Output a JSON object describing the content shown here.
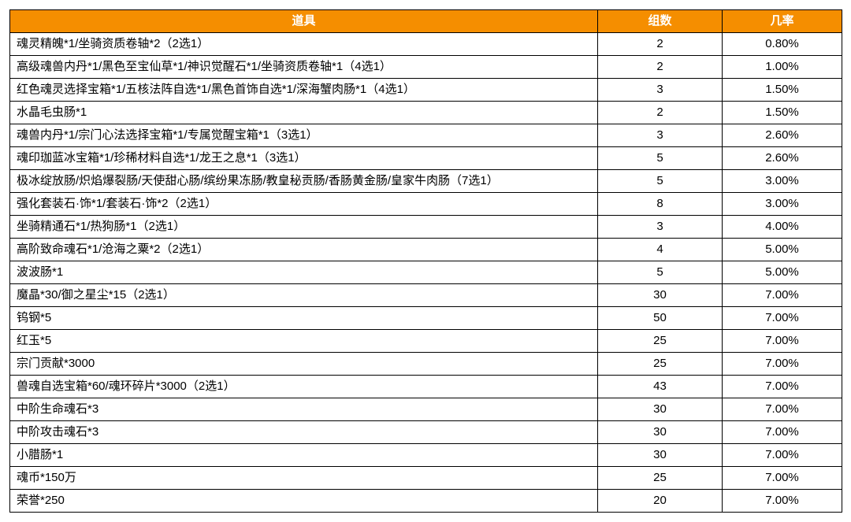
{
  "chart_data": {
    "type": "table",
    "title": "",
    "columns": [
      "道具",
      "组数",
      "几率"
    ],
    "rows": [
      {
        "item": "魂灵精魄*1/坐骑资质卷轴*2（2选1）",
        "count": 2,
        "rate": "0.80%"
      },
      {
        "item": "高级魂兽内丹*1/黑色至宝仙草*1/神识觉醒石*1/坐骑资质卷轴*1（4选1）",
        "count": 2,
        "rate": "1.00%"
      },
      {
        "item": "红色魂灵选择宝箱*1/五核法阵自选*1/黑色首饰自选*1/深海蟹肉肠*1（4选1）",
        "count": 3,
        "rate": "1.50%"
      },
      {
        "item": "水晶毛虫肠*1",
        "count": 2,
        "rate": "1.50%"
      },
      {
        "item": "魂兽内丹*1/宗门心法选择宝箱*1/专属觉醒宝箱*1（3选1）",
        "count": 3,
        "rate": "2.60%"
      },
      {
        "item": "魂印珈蓝冰宝箱*1/珍稀材料自选*1/龙王之息*1（3选1）",
        "count": 5,
        "rate": "2.60%"
      },
      {
        "item": "极冰绽放肠/炽焰爆裂肠/天使甜心肠/缤纷果冻肠/教皇秘贡肠/香肠黄金肠/皇家牛肉肠（7选1）",
        "count": 5,
        "rate": "3.00%"
      },
      {
        "item": "强化套装石·饰*1/套装石·饰*2（2选1）",
        "count": 8,
        "rate": "3.00%"
      },
      {
        "item": "坐骑精通石*1/热狗肠*1（2选1）",
        "count": 3,
        "rate": "4.00%"
      },
      {
        "item": "高阶致命魂石*1/沧海之粟*2（2选1）",
        "count": 4,
        "rate": "5.00%"
      },
      {
        "item": "波波肠*1",
        "count": 5,
        "rate": "5.00%"
      },
      {
        "item": "魔晶*30/御之星尘*15（2选1）",
        "count": 30,
        "rate": "7.00%"
      },
      {
        "item": "钨钢*5",
        "count": 50,
        "rate": "7.00%"
      },
      {
        "item": "红玉*5",
        "count": 25,
        "rate": "7.00%"
      },
      {
        "item": "宗门贡献*3000",
        "count": 25,
        "rate": "7.00%"
      },
      {
        "item": "兽魂自选宝箱*60/魂环碎片*3000（2选1）",
        "count": 43,
        "rate": "7.00%"
      },
      {
        "item": "中阶生命魂石*3",
        "count": 30,
        "rate": "7.00%"
      },
      {
        "item": "中阶攻击魂石*3",
        "count": 30,
        "rate": "7.00%"
      },
      {
        "item": "小腊肠*1",
        "count": 30,
        "rate": "7.00%"
      },
      {
        "item": "魂币*150万",
        "count": 25,
        "rate": "7.00%"
      },
      {
        "item": "荣誉*250",
        "count": 20,
        "rate": "7.00%"
      }
    ]
  }
}
